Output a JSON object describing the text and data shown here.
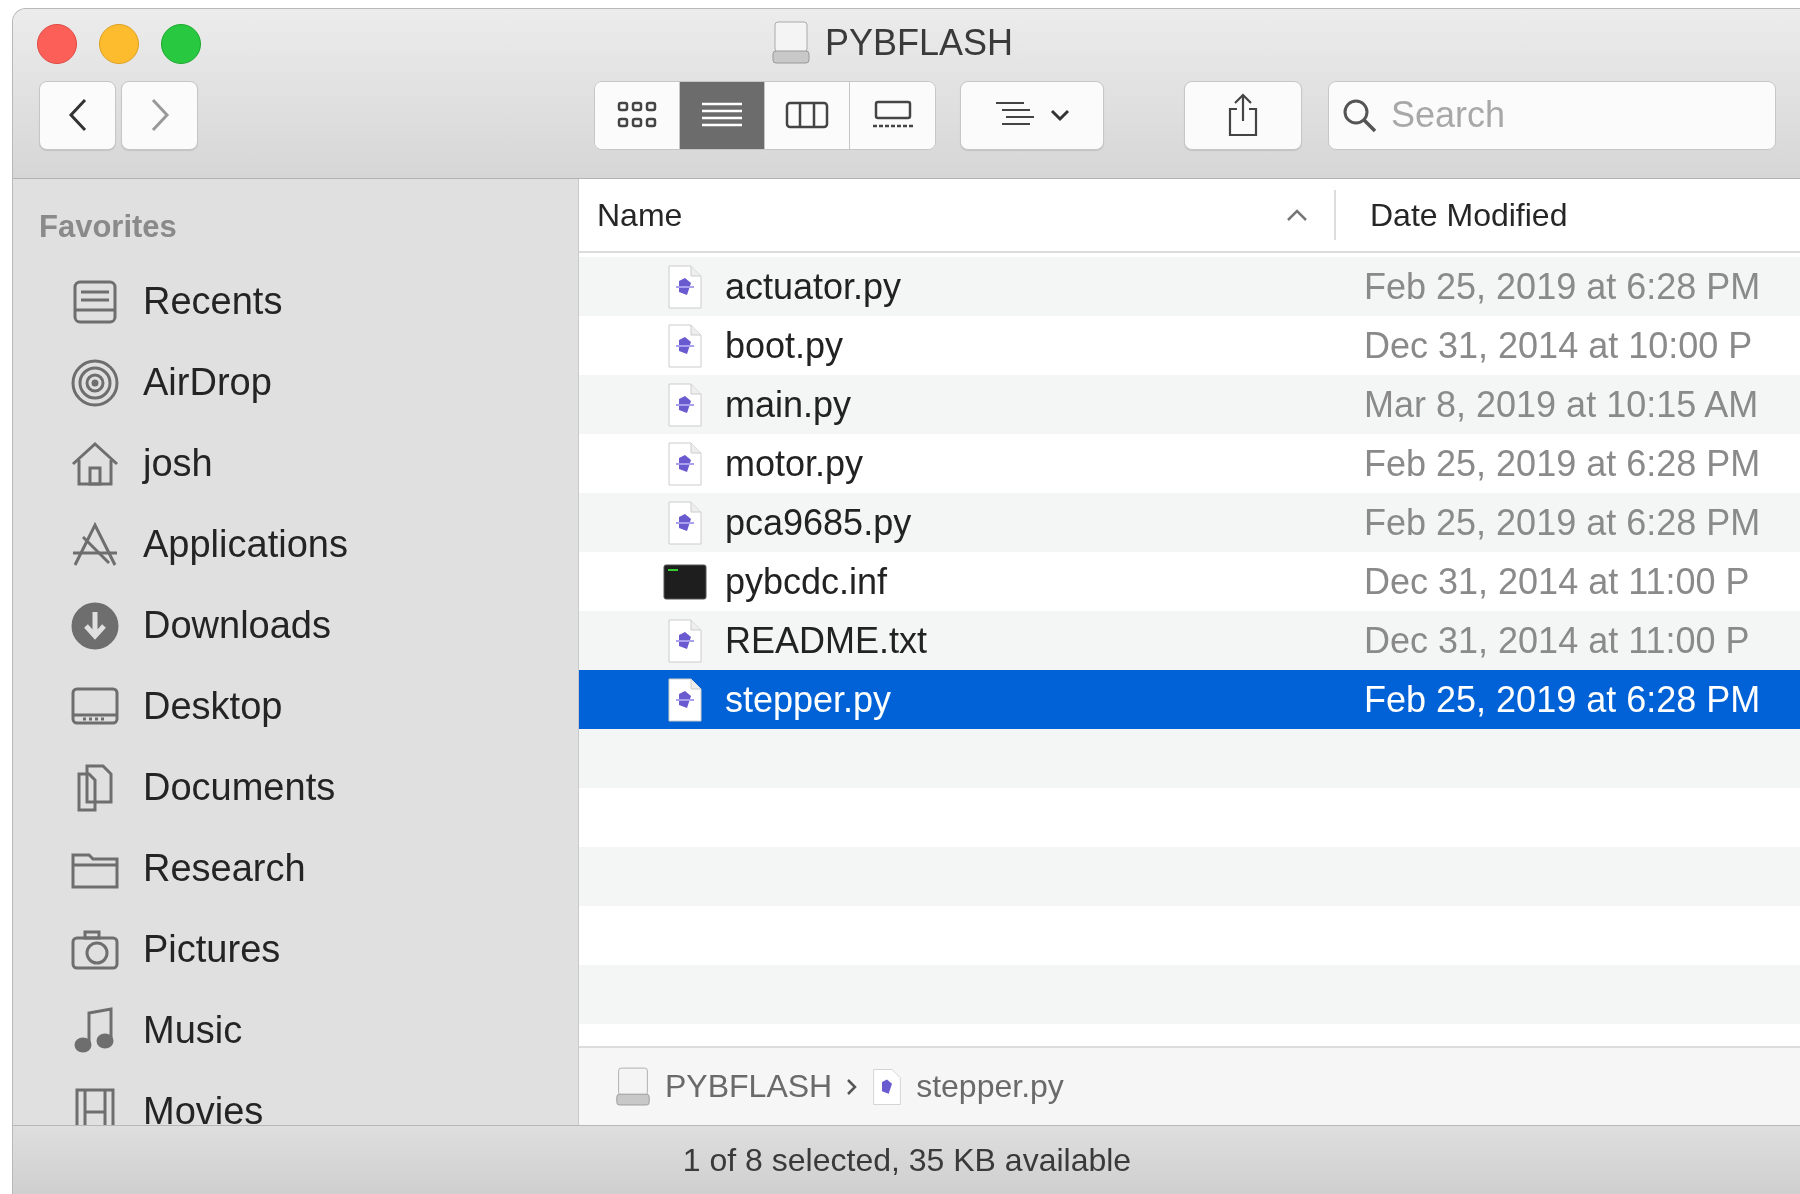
{
  "window": {
    "title": "PYBFLASH"
  },
  "toolbar": {
    "view_modes": [
      {
        "selected": false
      },
      {
        "selected": true
      },
      {
        "selected": false
      },
      {
        "selected": false
      }
    ],
    "search": {
      "placeholder": "Search"
    }
  },
  "sidebar": {
    "heading": "Favorites",
    "items": [
      {
        "label": "Recents"
      },
      {
        "label": "AirDrop"
      },
      {
        "label": "josh"
      },
      {
        "label": "Applications"
      },
      {
        "label": "Downloads"
      },
      {
        "label": "Desktop"
      },
      {
        "label": "Documents"
      },
      {
        "label": "Research"
      },
      {
        "label": "Pictures"
      },
      {
        "label": "Music"
      },
      {
        "label": "Movies"
      }
    ]
  },
  "table": {
    "columns": [
      {
        "label": "Name",
        "sorted": true
      },
      {
        "label": "Date Modified",
        "sorted": false
      }
    ],
    "rows": [
      {
        "kind": "script",
        "name": "actuator.py",
        "date": "Feb 25, 2019 at 6:28 PM",
        "selected": false
      },
      {
        "kind": "script",
        "name": "boot.py",
        "date": "Dec 31, 2014 at 10:00 P",
        "selected": false
      },
      {
        "kind": "script",
        "name": "main.py",
        "date": "Mar 8, 2019 at 10:15 AM",
        "selected": false
      },
      {
        "kind": "script",
        "name": "motor.py",
        "date": "Feb 25, 2019 at 6:28 PM",
        "selected": false
      },
      {
        "kind": "script",
        "name": "pca9685.py",
        "date": "Feb 25, 2019 at 6:28 PM",
        "selected": false
      },
      {
        "kind": "executable",
        "name": "pybcdc.inf",
        "date": "Dec 31, 2014 at 11:00 P",
        "selected": false
      },
      {
        "kind": "script",
        "name": "README.txt",
        "date": "Dec 31, 2014 at 11:00 P",
        "selected": false
      },
      {
        "kind": "script",
        "name": "stepper.py",
        "date": "Feb 25, 2019 at 6:28 PM",
        "selected": true
      }
    ]
  },
  "path_bar": [
    {
      "kind": "drive",
      "label": "PYBFLASH"
    },
    {
      "kind": "script",
      "label": "stepper.py"
    }
  ],
  "status_bar": "1 of 8 selected, 35 KB available"
}
